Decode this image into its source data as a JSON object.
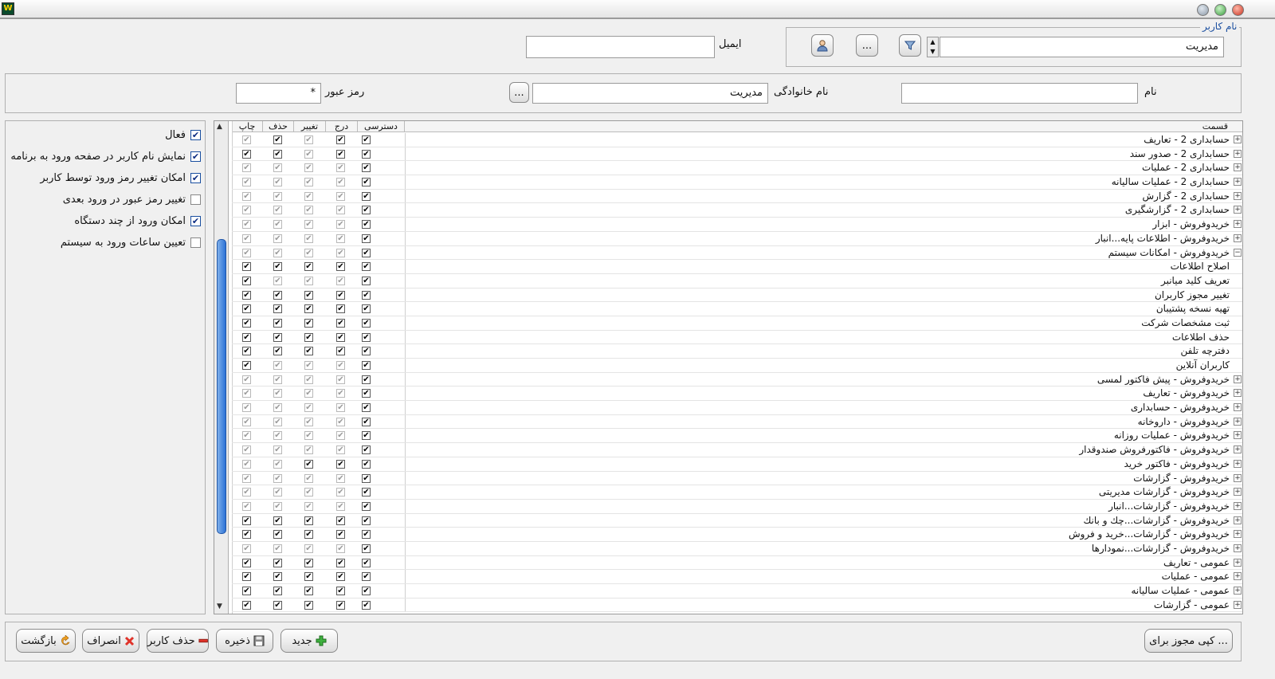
{
  "window": {
    "app_icon": "app-logo-icon"
  },
  "user_group": {
    "legend": "نام کاربر",
    "user_value": "مدیریت",
    "email_label": "ایمیل",
    "email_value": "",
    "dots_button": "..."
  },
  "personal": {
    "first_name_label": "نام",
    "first_name_value": "",
    "last_name_label": "نام خانوادگی",
    "last_name_value": "مدیریت",
    "dots_button": "...",
    "password_label": "رمز عبور",
    "password_value": "*"
  },
  "grid": {
    "columns": {
      "section": "قسمت",
      "access": "دسترسی",
      "insert": "درج",
      "edit": "تغییر",
      "delete": "حذف",
      "print": "چاپ"
    },
    "rows": [
      {
        "label": "حسابداری 2 - تعاریف",
        "expander": "+",
        "child": false,
        "access": true,
        "insert": true,
        "edit": false,
        "delete": true,
        "print": false
      },
      {
        "label": "حسابداری 2 - صدور سند",
        "expander": "+",
        "child": false,
        "access": true,
        "insert": true,
        "edit": false,
        "delete": true,
        "print": true
      },
      {
        "label": "حسابداری 2 - عملیات",
        "expander": "+",
        "child": false,
        "access": true,
        "insert": false,
        "edit": false,
        "delete": false,
        "print": false
      },
      {
        "label": "حسابداری 2 - عملیات سالیانه",
        "expander": "+",
        "child": false,
        "access": true,
        "insert": false,
        "edit": false,
        "delete": false,
        "print": false
      },
      {
        "label": "حسابداری 2 - گزارش",
        "expander": "+",
        "child": false,
        "access": true,
        "insert": false,
        "edit": false,
        "delete": false,
        "print": false
      },
      {
        "label": "حسابداری 2 - گزارشگیری",
        "expander": "+",
        "child": false,
        "access": true,
        "insert": false,
        "edit": false,
        "delete": false,
        "print": false
      },
      {
        "label": "خریدوفروش - ابزار",
        "expander": "+",
        "child": false,
        "access": true,
        "insert": false,
        "edit": false,
        "delete": false,
        "print": false
      },
      {
        "label": "خریدوفروش - اطلاعات پایه...انبار",
        "expander": "+",
        "child": false,
        "access": true,
        "insert": false,
        "edit": false,
        "delete": false,
        "print": false
      },
      {
        "label": "خریدوفروش - امکانات سیستم",
        "expander": "−",
        "child": false,
        "access": true,
        "insert": false,
        "edit": false,
        "delete": false,
        "print": false
      },
      {
        "label": "اصلاح اطلاعات",
        "expander": "",
        "child": true,
        "access": true,
        "insert": true,
        "edit": true,
        "delete": true,
        "print": true
      },
      {
        "label": "تعریف کلید میانبر",
        "expander": "",
        "child": true,
        "access": true,
        "insert": false,
        "edit": false,
        "delete": false,
        "print": true
      },
      {
        "label": "تغییر مجوز کاربران",
        "expander": "",
        "child": true,
        "access": true,
        "insert": true,
        "edit": true,
        "delete": true,
        "print": true
      },
      {
        "label": "تهیه نسخه پشتیبان",
        "expander": "",
        "child": true,
        "access": true,
        "insert": true,
        "edit": true,
        "delete": true,
        "print": true
      },
      {
        "label": "ثبت مشخصات شرکت",
        "expander": "",
        "child": true,
        "access": true,
        "insert": true,
        "edit": true,
        "delete": true,
        "print": true
      },
      {
        "label": "حذف اطلاعات",
        "expander": "",
        "child": true,
        "access": true,
        "insert": true,
        "edit": true,
        "delete": true,
        "print": true
      },
      {
        "label": "دفترچه تلفن",
        "expander": "",
        "child": true,
        "access": true,
        "insert": true,
        "edit": true,
        "delete": true,
        "print": true
      },
      {
        "label": "کاربران آنلاین",
        "expander": "",
        "child": true,
        "access": true,
        "insert": false,
        "edit": false,
        "delete": false,
        "print": true
      },
      {
        "label": "خریدوفروش - پیش فاکتور لمسی",
        "expander": "+",
        "child": false,
        "access": true,
        "insert": false,
        "edit": false,
        "delete": false,
        "print": false
      },
      {
        "label": "خریدوفروش - تعاریف",
        "expander": "+",
        "child": false,
        "access": true,
        "insert": false,
        "edit": false,
        "delete": false,
        "print": false
      },
      {
        "label": "خریدوفروش - حسابداری",
        "expander": "+",
        "child": false,
        "access": true,
        "insert": false,
        "edit": false,
        "delete": false,
        "print": false
      },
      {
        "label": "خریدوفروش - داروخانه",
        "expander": "+",
        "child": false,
        "access": true,
        "insert": false,
        "edit": false,
        "delete": false,
        "print": false
      },
      {
        "label": "خریدوفروش - عملیات روزانه",
        "expander": "+",
        "child": false,
        "access": true,
        "insert": false,
        "edit": false,
        "delete": false,
        "print": false
      },
      {
        "label": "خریدوفروش - فاکتورفروش صندوقدار",
        "expander": "+",
        "child": false,
        "access": true,
        "insert": false,
        "edit": false,
        "delete": false,
        "print": false
      },
      {
        "label": "خریدوفروش - فاکتور خرید",
        "expander": "+",
        "child": false,
        "access": true,
        "insert": true,
        "edit": true,
        "delete": false,
        "print": false
      },
      {
        "label": "خریدوفروش - گزارشات",
        "expander": "+",
        "child": false,
        "access": true,
        "insert": false,
        "edit": false,
        "delete": false,
        "print": false
      },
      {
        "label": "خریدوفروش - گزارشات مدیریتی",
        "expander": "+",
        "child": false,
        "access": true,
        "insert": false,
        "edit": false,
        "delete": false,
        "print": false
      },
      {
        "label": "خریدوفروش - گزارشات...انبار",
        "expander": "+",
        "child": false,
        "access": true,
        "insert": false,
        "edit": false,
        "delete": false,
        "print": false
      },
      {
        "label": "خریدوفروش - گزارشات...چك و بانك",
        "expander": "+",
        "child": false,
        "access": true,
        "insert": true,
        "edit": true,
        "delete": true,
        "print": true
      },
      {
        "label": "خریدوفروش - گزارشات...خرید و فروش",
        "expander": "+",
        "child": false,
        "access": true,
        "insert": true,
        "edit": true,
        "delete": true,
        "print": true
      },
      {
        "label": "خریدوفروش - گزارشات...نمودارها",
        "expander": "+",
        "child": false,
        "access": true,
        "insert": false,
        "edit": false,
        "delete": false,
        "print": false
      },
      {
        "label": "عمومی - تعاریف",
        "expander": "+",
        "child": false,
        "access": true,
        "insert": true,
        "edit": true,
        "delete": true,
        "print": true
      },
      {
        "label": "عمومی - عملیات",
        "expander": "+",
        "child": false,
        "access": true,
        "insert": true,
        "edit": true,
        "delete": true,
        "print": true
      },
      {
        "label": "عمومی - عملیات سالیانه",
        "expander": "+",
        "child": false,
        "access": true,
        "insert": true,
        "edit": true,
        "delete": true,
        "print": true
      },
      {
        "label": "عمومی - گزارشات",
        "expander": "+",
        "child": false,
        "access": true,
        "insert": true,
        "edit": true,
        "delete": true,
        "print": true
      }
    ]
  },
  "options": [
    {
      "label": "فعال",
      "checked": true
    },
    {
      "label": "نمایش نام کاربر در صفحه ورود به برنامه",
      "checked": true
    },
    {
      "label": "امکان تغییر رمز ورود توسط کاربر",
      "checked": true
    },
    {
      "label": "تغییر رمز عبور در ورود بعدی",
      "checked": false
    },
    {
      "label": "امکان ورود از چند دستگاه",
      "checked": true
    },
    {
      "label": "تعیین ساعات ورود به سیستم",
      "checked": false
    }
  ],
  "footer": {
    "copy_permissions": "کپی مجوز برای ...",
    "new": "جدید",
    "save": "ذخیره",
    "delete_user": "حذف کاربر",
    "cancel": "انصراف",
    "back": "بازگشت"
  },
  "colors": {
    "accent": "#1b4fa0",
    "scroll_thumb": "#2d72d6",
    "close": "#d83b2a",
    "maximize": "#46b34a",
    "minimize": "#9aa7b5"
  }
}
